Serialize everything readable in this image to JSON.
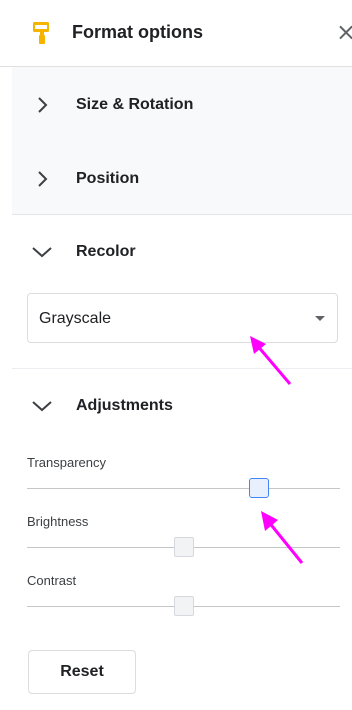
{
  "header": {
    "title": "Format options",
    "icon": "paint-roller-icon",
    "close_icon": "close-icon",
    "close_glyph": "×"
  },
  "sections": {
    "size_rotation": {
      "label": "Size & Rotation",
      "state": "collapsed"
    },
    "position": {
      "label": "Position",
      "state": "collapsed"
    },
    "recolor": {
      "label": "Recolor",
      "state": "expanded",
      "selected_option": "Grayscale"
    },
    "adjustments": {
      "label": "Adjustments",
      "state": "expanded",
      "sliders": {
        "transparency": {
          "label": "Transparency",
          "value_fraction": 0.74
        },
        "brightness": {
          "label": "Brightness",
          "value_fraction": 0.5
        },
        "contrast": {
          "label": "Contrast",
          "value_fraction": 0.5
        }
      }
    }
  },
  "reset_label": "Reset",
  "colors": {
    "accent_icon": "#f4b400",
    "slider_active_border": "#4285f4",
    "annotation_arrow": "#ff00ff",
    "collapsed_bg": "#f8f9fa"
  }
}
